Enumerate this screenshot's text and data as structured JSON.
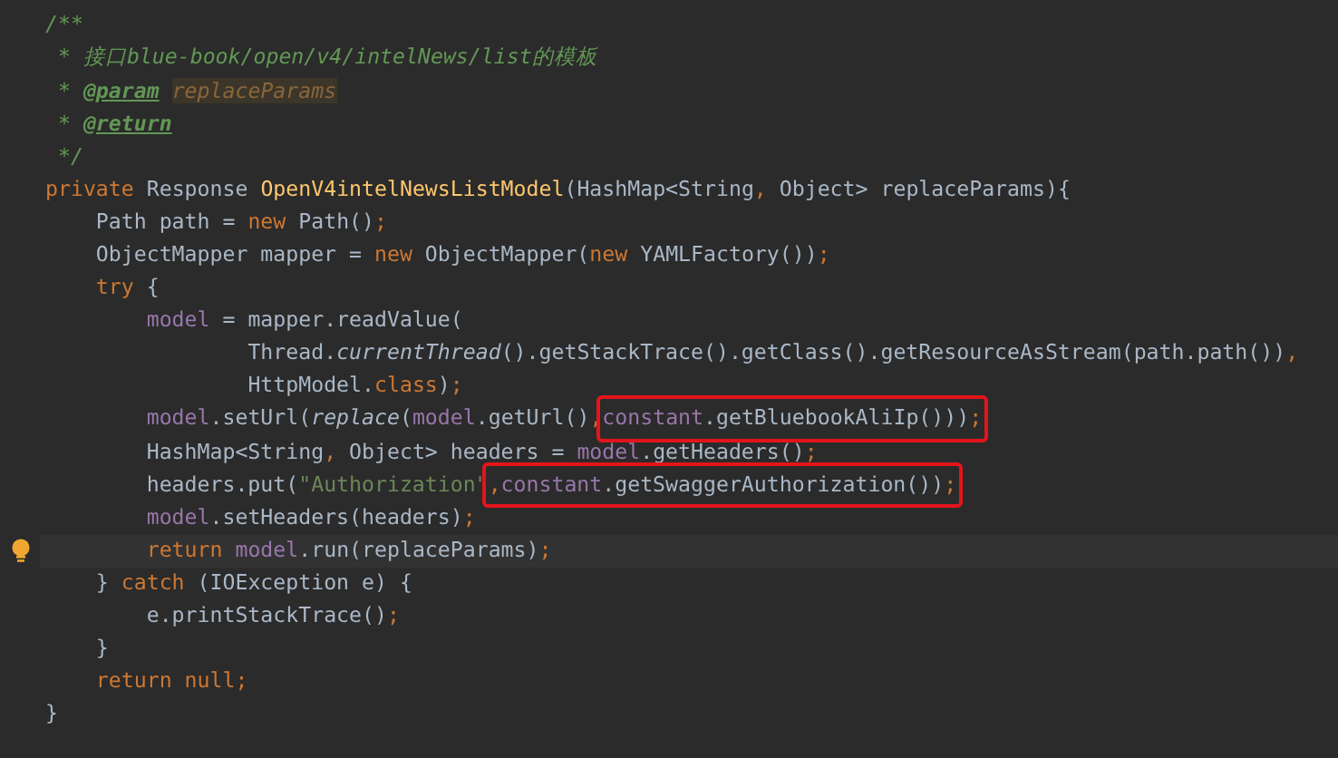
{
  "editor": {
    "lines": [
      {
        "current": false,
        "tokens": [
          {
            "text": "/**",
            "kind": "doc"
          }
        ]
      },
      {
        "current": false,
        "tokens": [
          {
            "text": " * 接口blue-book/open/v4/intelNews/list的模板",
            "kind": "doc"
          }
        ]
      },
      {
        "current": false,
        "tokens": [
          {
            "text": " * ",
            "kind": "doc"
          },
          {
            "text": "@param",
            "kind": "doc-tag"
          },
          {
            "text": " replaceParams",
            "kind": "doc-ref"
          }
        ]
      },
      {
        "current": false,
        "tokens": [
          {
            "text": " * ",
            "kind": "doc"
          },
          {
            "text": "@return",
            "kind": "doc-tag"
          }
        ]
      },
      {
        "current": false,
        "tokens": [
          {
            "text": " */",
            "kind": "doc"
          }
        ]
      },
      {
        "current": false,
        "tokens": [
          {
            "text": "private",
            "kind": "keyword"
          },
          {
            "text": " Response ",
            "kind": "plain"
          },
          {
            "text": "OpenV4intelNewsListModel",
            "kind": "decl"
          },
          {
            "text": "(HashMap<String",
            "kind": "plain"
          },
          {
            "text": ",",
            "kind": "keyword"
          },
          {
            "text": " Object> replaceParams){",
            "kind": "plain"
          }
        ]
      },
      {
        "current": false,
        "tokens": [
          {
            "text": "    Path path = ",
            "kind": "plain"
          },
          {
            "text": "new",
            "kind": "keyword"
          },
          {
            "text": " Path()",
            "kind": "plain"
          },
          {
            "text": ";",
            "kind": "keyword"
          }
        ]
      },
      {
        "current": false,
        "tokens": [
          {
            "text": "    ObjectMapper mapper = ",
            "kind": "plain"
          },
          {
            "text": "new",
            "kind": "keyword"
          },
          {
            "text": " ObjectMapper(",
            "kind": "plain"
          },
          {
            "text": "new",
            "kind": "keyword"
          },
          {
            "text": " YAMLFactory())",
            "kind": "plain"
          },
          {
            "text": ";",
            "kind": "keyword"
          }
        ]
      },
      {
        "current": false,
        "tokens": [
          {
            "text": "    try",
            "kind": "keyword"
          },
          {
            "text": " {",
            "kind": "plain"
          }
        ]
      },
      {
        "current": false,
        "tokens": [
          {
            "text": "        model",
            "kind": "field"
          },
          {
            "text": " = mapper.readValue(",
            "kind": "plain"
          }
        ]
      },
      {
        "current": false,
        "tokens": [
          {
            "text": "                Thread.",
            "kind": "plain"
          },
          {
            "text": "currentThread",
            "kind": "italic"
          },
          {
            "text": "().getStackTrace().getClass().getResourceAsStream(path.path())",
            "kind": "plain"
          },
          {
            "text": ",",
            "kind": "keyword"
          }
        ]
      },
      {
        "current": false,
        "tokens": [
          {
            "text": "                HttpModel.",
            "kind": "plain"
          },
          {
            "text": "class",
            "kind": "keyword"
          },
          {
            "text": ")",
            "kind": "plain"
          },
          {
            "text": ";",
            "kind": "keyword"
          }
        ]
      },
      {
        "current": false,
        "tokens": [
          {
            "text": "        model",
            "kind": "field"
          },
          {
            "text": ".setUrl(",
            "kind": "plain"
          },
          {
            "text": "replace",
            "kind": "italic"
          },
          {
            "text": "(",
            "kind": "plain"
          },
          {
            "text": "model",
            "kind": "field"
          },
          {
            "text": ".getUrl()",
            "kind": "plain"
          },
          {
            "text": ",",
            "kind": "keyword"
          },
          {
            "kind": "box",
            "tokens": [
              {
                "text": "constant",
                "kind": "field"
              },
              {
                "text": ".getBluebookAliIp()))",
                "kind": "plain"
              },
              {
                "text": ";",
                "kind": "keyword"
              }
            ]
          }
        ]
      },
      {
        "current": false,
        "tokens": [
          {
            "text": "        HashMap<String",
            "kind": "plain"
          },
          {
            "text": ",",
            "kind": "keyword"
          },
          {
            "text": " Object> headers = ",
            "kind": "plain"
          },
          {
            "text": "model",
            "kind": "field"
          },
          {
            "text": ".getHeaders()",
            "kind": "plain"
          },
          {
            "text": ";",
            "kind": "keyword"
          }
        ]
      },
      {
        "current": false,
        "tokens": [
          {
            "text": "        headers.put(",
            "kind": "plain"
          },
          {
            "text": "\"Authorization\"",
            "kind": "string"
          },
          {
            "kind": "box",
            "tokens": [
              {
                "text": ",",
                "kind": "keyword"
              },
              {
                "text": "constant",
                "kind": "field"
              },
              {
                "text": ".getSwaggerAuthorization())",
                "kind": "plain"
              },
              {
                "text": ";",
                "kind": "keyword"
              }
            ]
          }
        ]
      },
      {
        "current": false,
        "tokens": [
          {
            "text": "        model",
            "kind": "field"
          },
          {
            "text": ".setHeaders(headers)",
            "kind": "plain"
          },
          {
            "text": ";",
            "kind": "keyword"
          }
        ]
      },
      {
        "current": true,
        "tokens": [
          {
            "text": "        return",
            "kind": "keyword"
          },
          {
            "text": " model",
            "kind": "field"
          },
          {
            "text": ".run(replaceParams)",
            "kind": "plain"
          },
          {
            "text": ";",
            "kind": "keyword"
          }
        ]
      },
      {
        "current": false,
        "tokens": [
          {
            "text": "    } ",
            "kind": "plain"
          },
          {
            "text": "catch",
            "kind": "keyword"
          },
          {
            "text": " (IOException e) {",
            "kind": "plain"
          }
        ]
      },
      {
        "current": false,
        "tokens": [
          {
            "text": "        e.printStackTrace()",
            "kind": "plain"
          },
          {
            "text": ";",
            "kind": "keyword"
          }
        ]
      },
      {
        "current": false,
        "tokens": [
          {
            "text": "    }",
            "kind": "plain"
          }
        ]
      },
      {
        "current": false,
        "tokens": [
          {
            "text": "    return null;",
            "kind": "keyword"
          }
        ]
      },
      {
        "current": false,
        "tokens": [
          {
            "text": "}",
            "kind": "plain"
          }
        ]
      }
    ]
  }
}
